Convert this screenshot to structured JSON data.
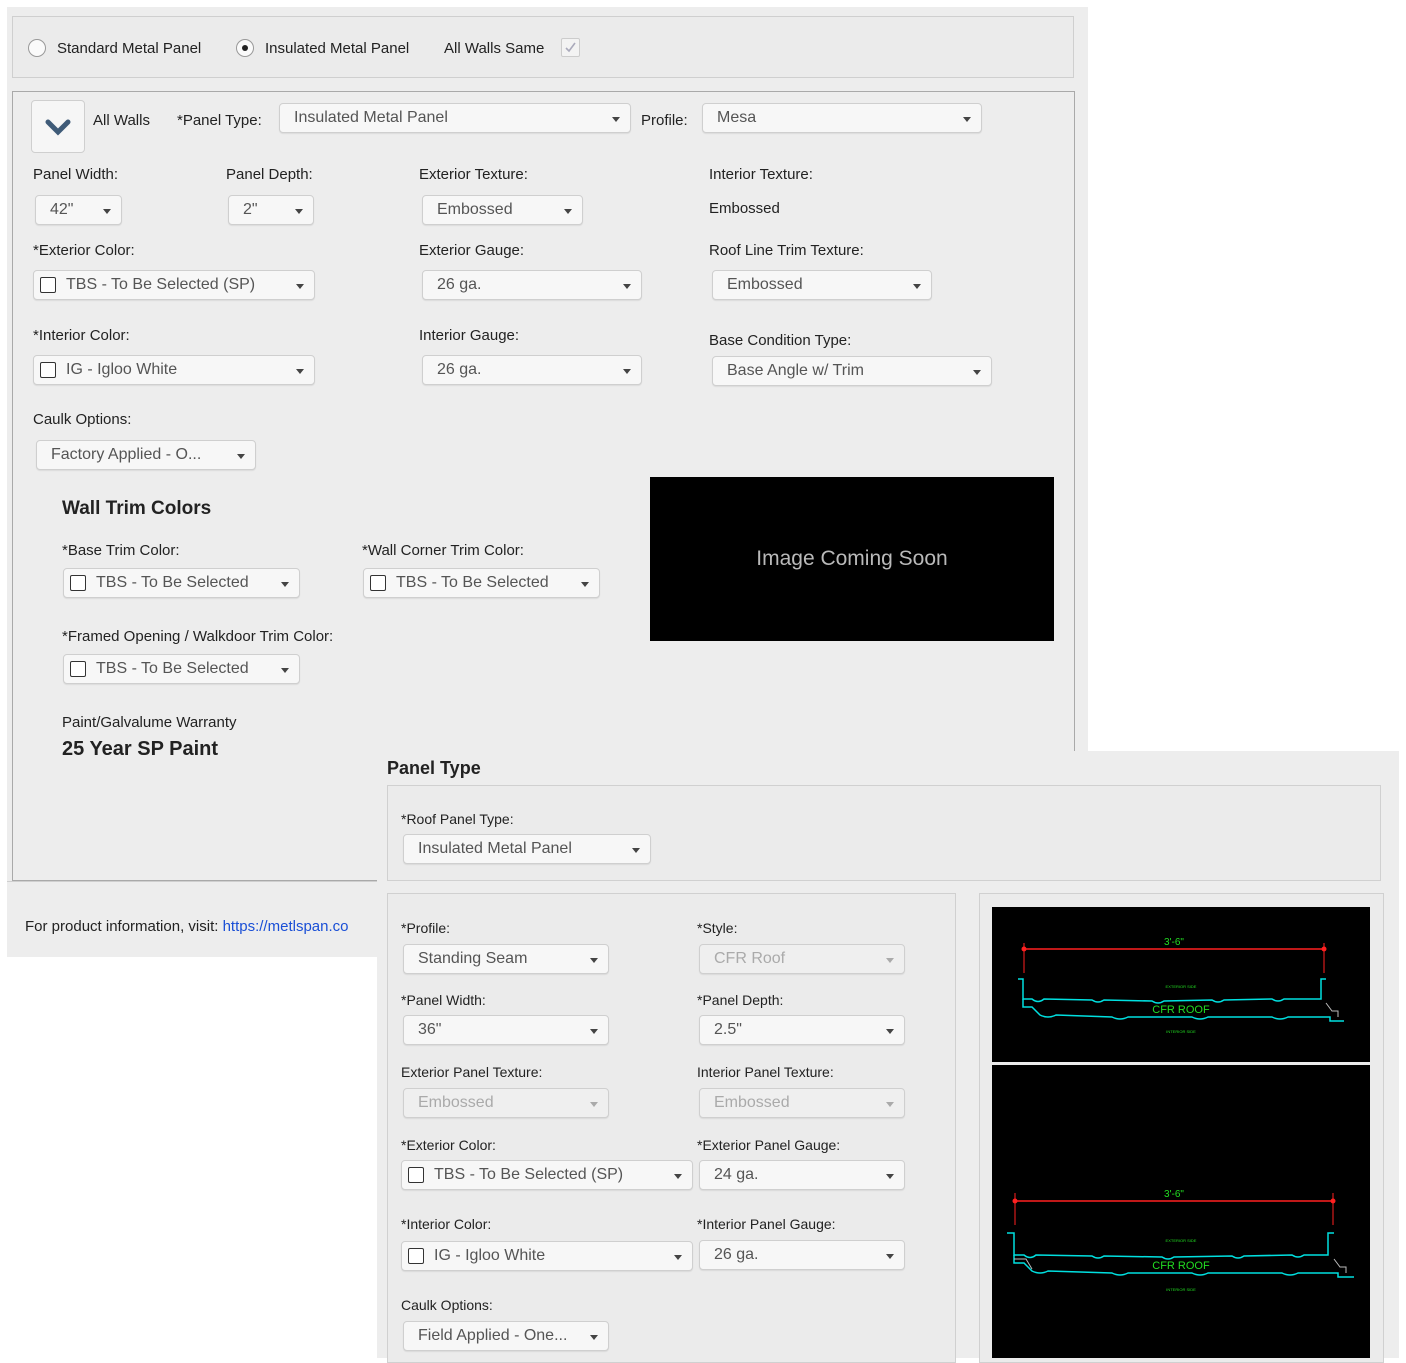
{
  "top_bar": {
    "standard_label": "Standard Metal Panel",
    "insulated_label": "Insulated Metal Panel",
    "all_walls_same_label": "All Walls Same"
  },
  "walls": {
    "all_walls_label": "All Walls",
    "panel_type_label": "*Panel Type:",
    "panel_type_value": "Insulated Metal Panel",
    "profile_label": "Profile:",
    "profile_value": "Mesa",
    "panel_width_label": "Panel Width:",
    "panel_width_value": "42\"",
    "panel_depth_label": "Panel Depth:",
    "panel_depth_value": "2\"",
    "exterior_texture_label": "Exterior Texture:",
    "exterior_texture_value": "Embossed",
    "interior_texture_label": "Interior Texture:",
    "interior_texture_value": "Embossed",
    "exterior_color_label": "*Exterior Color:",
    "exterior_color_value": "TBS - To Be Selected (SP)",
    "exterior_gauge_label": "Exterior Gauge:",
    "exterior_gauge_value": "26 ga.",
    "roof_line_trim_label": "Roof Line Trim Texture:",
    "roof_line_trim_value": "Embossed",
    "interior_color_label": "*Interior Color:",
    "interior_color_value": "IG - Igloo White",
    "interior_gauge_label": "Interior Gauge:",
    "interior_gauge_value": "26 ga.",
    "base_condition_label": "Base Condition Type:",
    "base_condition_value": "Base Angle w/ Trim",
    "caulk_label": "Caulk Options:",
    "caulk_value": "Factory Applied - O...",
    "trim_heading": "Wall Trim Colors",
    "base_trim_label": "*Base Trim Color:",
    "base_trim_value": "TBS - To Be Selected",
    "corner_trim_label": "*Wall Corner Trim Color:",
    "corner_trim_value": "TBS - To Be Selected",
    "framed_label": "*Framed Opening / Walkdoor Trim Color:",
    "framed_value": "TBS - To Be Selected",
    "image_placeholder": "Image Coming Soon",
    "warranty_label": "Paint/Galvalume Warranty",
    "warranty_value": "25 Year SP Paint",
    "footer_text": "For product information, visit: ",
    "footer_link": "https://metlspan.co"
  },
  "roof": {
    "heading": "Panel Type",
    "roof_panel_type_label": "*Roof Panel Type:",
    "roof_panel_type_value": "Insulated Metal Panel",
    "profile_label": "*Profile:",
    "profile_value": "Standing Seam",
    "style_label": "*Style:",
    "style_value": "CFR Roof",
    "panel_width_label": "*Panel Width:",
    "panel_width_value": "36\"",
    "panel_depth_label": "*Panel Depth:",
    "panel_depth_value": "2.5\"",
    "ext_texture_label": "Exterior Panel Texture:",
    "ext_texture_value": "Embossed",
    "int_texture_label": "Interior Panel Texture:",
    "int_texture_value": "Embossed",
    "ext_color_label": "*Exterior Color:",
    "ext_color_value": "TBS - To Be Selected (SP)",
    "ext_gauge_label": "*Exterior Panel Gauge:",
    "ext_gauge_value": "24 ga.",
    "int_color_label": "*Interior Color:",
    "int_color_value": "IG - Igloo White",
    "int_gauge_label": "*Interior Panel Gauge:",
    "int_gauge_value": "26 ga.",
    "caulk_label": "Caulk Options:",
    "caulk_value": "Field Applied - One...",
    "drawing1": {
      "dimension": "3'-6\"",
      "exterior_side": "EXTERIOR SIDE",
      "name": "CFR ROOF",
      "interior_side": "INTERIOR SIDE"
    },
    "drawing2": {
      "dimension": "3'-6\"",
      "exterior_side": "EXTERIOR SIDE",
      "name": "CFR ROOF",
      "interior_side": "INTERIOR SIDE"
    }
  },
  "colors": {
    "panel_bg": "#ededed",
    "link": "#1a4fd6",
    "drawing_red": "#ff2020",
    "drawing_cyan": "#00e0e0",
    "drawing_green": "#22dd22"
  }
}
